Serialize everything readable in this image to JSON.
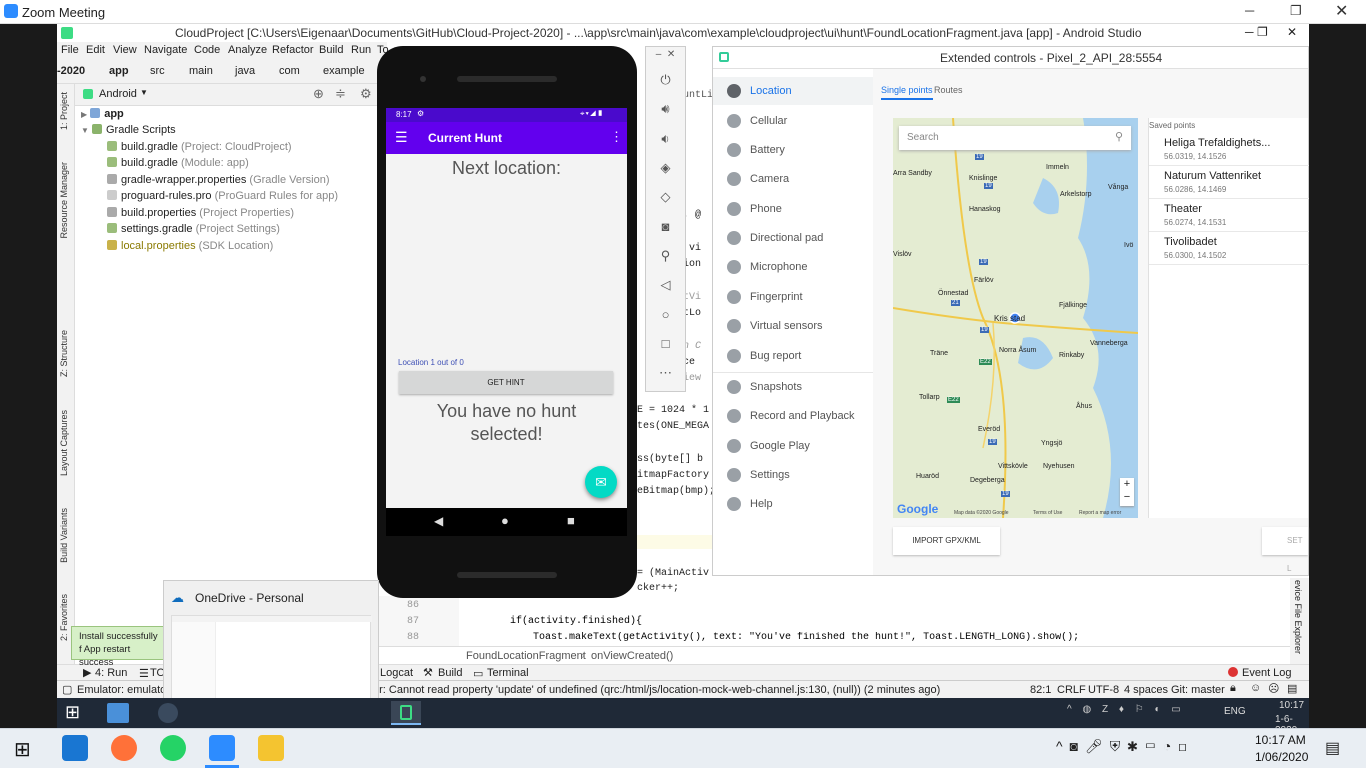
{
  "zoom": {
    "title": "Zoom Meeting"
  },
  "studio": {
    "title": "CloudProject [C:\\Users\\Eigenaar\\Documents\\GitHub\\Cloud-Project-2020] - ...\\app\\src\\main\\java\\com\\example\\cloudproject\\ui\\hunt\\FoundLocationFragment.java [app] - Android Studio",
    "menu": [
      "File",
      "Edit",
      "View",
      "Navigate",
      "Code",
      "Analyze",
      "Refactor",
      "Build",
      "Run",
      "To"
    ],
    "nav": [
      "-2020",
      "app",
      "src",
      "main",
      "java",
      "com",
      "example"
    ],
    "project_view": "Android",
    "left_tabs": [
      "1: Project",
      "Resource Manager",
      "Z: Structure",
      "Layout Captures",
      "Build Variants",
      "2: Favorites"
    ],
    "tree": [
      {
        "label": "app",
        "sub": ""
      },
      {
        "label": "Gradle Scripts",
        "sub": ""
      },
      {
        "label": "build.gradle",
        "sub": "(Project: CloudProject)"
      },
      {
        "label": "build.gradle",
        "sub": "(Module: app)"
      },
      {
        "label": "gradle-wrapper.properties",
        "sub": "(Gradle Version)"
      },
      {
        "label": "proguard-rules.pro",
        "sub": "(ProGuard Rules for app)"
      },
      {
        "label": "build.properties",
        "sub": "(Project Properties)"
      },
      {
        "label": "settings.gradle",
        "sub": "(Project Settings)"
      },
      {
        "label": "local.properties",
        "sub": "(SDK Location)"
      }
    ],
    "code_fragments": [
      "untLis",
      "w, @",
      ") vi",
      "tion",
      "xtVi",
      "etLo",
      "in C",
      "nce",
      "View",
      "E = 1024 * 1",
      "tes(ONE_MEGA",
      "ss(byte[] b",
      "itmapFactory",
      "eBitmap(bmp);",
      "= (MainActiv",
      "cker++;"
    ],
    "code_lines": [
      {
        "n": "86",
        "text": ""
      },
      {
        "n": "87",
        "text": "if(activity.finished){"
      },
      {
        "n": "88",
        "text": "Toast.makeText(getActivity(),  text: \"You've finished the hunt!\", Toast.LENGTH_LONG).show();"
      }
    ],
    "breadcrumb": [
      "FoundLocationFragment",
      "onViewCreated()"
    ],
    "right_tab": "evice File Explorer",
    "tool_tabs": [
      "4: Run",
      "TO",
      "Logcat",
      "Build",
      "Terminal"
    ],
    "event_log": "Event Log",
    "status_left": "Emulator: emulator:",
    "status_msg": "or: Cannot read property 'update' of undefined (qrc:/html/js/location-mock-web-channel.js:130, (null)) (2 minutes ago)",
    "status_right": [
      "82:1",
      "CRLF",
      "UTF-8",
      "4 spaces",
      "Git: master"
    ],
    "toast": "Install successfully f App restart success"
  },
  "phone": {
    "time": "8:17",
    "toolbar_title": "Current Hunt",
    "heading": "Next location:",
    "location_count": "Location 1 out of 0",
    "hint_button": "GET HINT",
    "empty_msg": "You have no hunt selected!"
  },
  "extended": {
    "title": "Extended controls - Pixel_2_API_28:5554",
    "nav": [
      "Location",
      "Cellular",
      "Battery",
      "Camera",
      "Phone",
      "Directional pad",
      "Microphone",
      "Fingerprint",
      "Virtual sensors",
      "Bug report",
      "Snapshots",
      "Record and Playback",
      "Google Play",
      "Settings",
      "Help"
    ],
    "tabs": [
      "Single points",
      "Routes"
    ],
    "search_placeholder": "Search",
    "saved_header": "Saved points",
    "saved": [
      {
        "name": "Heliga Trefaldighets...",
        "coords": "56.0319, 14.1526"
      },
      {
        "name": "Naturum Vattenriket",
        "coords": "56.0286, 14.1469"
      },
      {
        "name": "Theater",
        "coords": "56.0274, 14.1531"
      },
      {
        "name": "Tivolibadet",
        "coords": "56.0300, 14.1502"
      }
    ],
    "map_labels": [
      "Immeln",
      "Arkelstorp",
      "Vånga",
      "Knislinge",
      "Hanaskog",
      "Arra Sandby",
      "Vislöv",
      "Färlöv",
      "Önnestad",
      "Fjälkinge",
      "Kris stad",
      "Norra Åsum",
      "Rinkaby",
      "Vanneberga",
      "Träne",
      "Tollarp",
      "Åhus",
      "Everöd",
      "Yngsjö",
      "Vittskövle",
      "Nyehusen",
      "Huaröd",
      "Degeberga",
      "Ivö"
    ],
    "road_numbers": [
      "19",
      "19",
      "19",
      "21",
      "19",
      "E22",
      "E22",
      "19",
      "19"
    ],
    "map_footer": [
      "Google",
      "Map data ©2020 Google",
      "Terms of Use",
      "Report a map error"
    ],
    "import_button": "IMPORT GPX/KML",
    "set_button": "SET L"
  },
  "onedrive": {
    "title": "OneDrive - Personal"
  },
  "clock": {
    "time": "10:17 AM",
    "date": "1/06/2020",
    "inner_time": "10:17",
    "inner_date": "1-6-2020",
    "lang": "ENG"
  }
}
